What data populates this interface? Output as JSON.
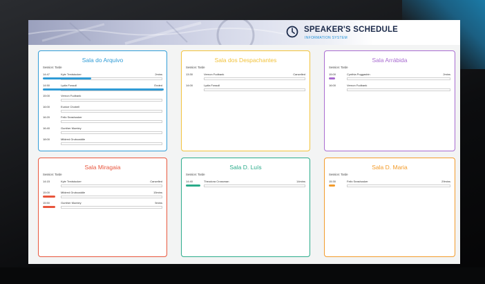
{
  "header": {
    "title": "SPEAKER'S SCHEDULE",
    "subtitle": "INFORMATION SYSTEM",
    "icon": "clock-icon"
  },
  "rooms": [
    {
      "name": "Sala do Arquivo",
      "session": "Session: Tarde",
      "color": "#2f9bd6",
      "rows": [
        {
          "time": "14:47",
          "speaker": "Kyle Tredstocker",
          "status": "2mins",
          "progress": 0.4
        },
        {
          "time": "14:50",
          "speaker": "Lydia Fossull",
          "status": "Ended",
          "progress": 1.0
        },
        {
          "time": "15:00",
          "speaker": "Vernon Fudbank",
          "status": "",
          "progress": 0
        },
        {
          "time": "16:00",
          "speaker": "Eunice Chobell",
          "status": "",
          "progress": 0
        },
        {
          "time": "16:20",
          "speaker": "Felix Seashusker",
          "status": "",
          "progress": 0
        },
        {
          "time": "16:40",
          "speaker": "Gunther Mumley",
          "status": "",
          "progress": 0
        },
        {
          "time": "18:00",
          "speaker": "Mildred Gruboaddle",
          "status": "",
          "progress": 0
        }
      ]
    },
    {
      "name": "Sala dos Despachantes",
      "session": "Session: Tarde",
      "color": "#f2c23a",
      "rows": [
        {
          "time": "13:30",
          "speaker": "Vernon Fudbank",
          "status": "Cancelled",
          "progress": 0
        },
        {
          "time": "14:00",
          "speaker": "Lydia Fossull",
          "status": "",
          "progress": 0
        }
      ]
    },
    {
      "name": "Sala Arrábida",
      "session": "Session: Tarde",
      "color": "#a86bd0",
      "rows": [
        {
          "time": "15:00",
          "speaker": "Cynthia Poggasbin",
          "status": "2mins",
          "progress": 0.05
        },
        {
          "time": "16:00",
          "speaker": "Vernon Fudbank",
          "status": "",
          "progress": 0
        }
      ]
    },
    {
      "name": "Sala Miragaia",
      "session": "Session: Tarde",
      "color": "#e8553c",
      "rows": [
        {
          "time": "14:15",
          "speaker": "Kyle Tredstocker",
          "status": "Cancelled",
          "progress": 0
        },
        {
          "time": "15:00",
          "speaker": "Mildred Gruboaddle",
          "status": "15mins",
          "progress": 0.1
        },
        {
          "time": "15:50",
          "speaker": "Gunther Mumley",
          "status": "5mins",
          "progress": 0.1
        }
      ]
    },
    {
      "name": "Sala D. Luís",
      "session": "Session: Tarde",
      "color": "#2aab8a",
      "rows": [
        {
          "time": "14:40",
          "speaker": "Theodora Crossman",
          "status": "14mins",
          "progress": 0.12
        }
      ]
    },
    {
      "name": "Sala D. Maria",
      "session": "Session: Tarde",
      "color": "#f39b2a",
      "rows": [
        {
          "time": "15:30",
          "speaker": "Felix Seashusker",
          "status": "29mins",
          "progress": 0.05
        }
      ]
    }
  ]
}
